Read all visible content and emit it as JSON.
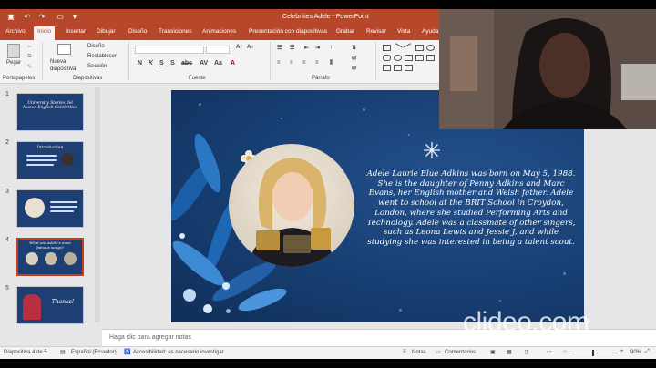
{
  "window": {
    "title": "Celebrities Adele  -  PowerPoint"
  },
  "tabs": [
    {
      "label": "Archivo"
    },
    {
      "label": "Inicio"
    },
    {
      "label": "Insertar"
    },
    {
      "label": "Dibujar"
    },
    {
      "label": "Diseño"
    },
    {
      "label": "Transiciones"
    },
    {
      "label": "Animaciones"
    },
    {
      "label": "Presentación con diapositivas"
    },
    {
      "label": "Grabar"
    },
    {
      "label": "Revisar"
    },
    {
      "label": "Vista"
    },
    {
      "label": "Ayuda"
    }
  ],
  "ribbon": {
    "paste_label": "Pegar",
    "new_slide_label": "Nueva diapositiva",
    "layout_label": "Diseño",
    "reset_label": "Restablecer",
    "section_label": "Sección",
    "groups": {
      "clipboard": "Portapapeles",
      "slides": "Diapositivas",
      "font": "Fuente",
      "paragraph": "Párrafo"
    }
  },
  "thumbnails": [
    {
      "number": "1",
      "title": "University Stories del Nuevo English Celebrities"
    },
    {
      "number": "2",
      "title": "Introduction"
    },
    {
      "number": "3",
      "title": ""
    },
    {
      "number": "4",
      "title": "What are Adele's most famous songs?"
    },
    {
      "number": "5",
      "title": "Thanks!"
    }
  ],
  "slide": {
    "body": "Adele Laurie Blue Adkins was born on May 5, 1988. She is the daughter of Penny Adkins and Marc Evans, her English mother and Welsh father. Adele went to school at the BRIT School in Croydon, London, where she studied Performing Arts and Technology. Adele was a classmate of other singers, such as Leona Lewis and Jessie J, and while studying she was interested in being a talent scout."
  },
  "notes": {
    "placeholder": "Haga clic para agregar notas"
  },
  "status": {
    "slide_of": "Diapositiva 4 de 5",
    "language": "Español (Ecuador)",
    "accessibility": "Accesibilidad: es necesario investigar",
    "notes": "Notas",
    "comments": "Comentarios",
    "zoom": "90%"
  },
  "watermark": "clideo.com",
  "colors": {
    "accent": "#b7472a",
    "slide_bg": "#173e72"
  }
}
